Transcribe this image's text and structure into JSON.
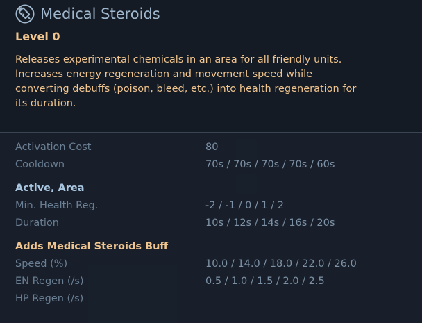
{
  "skill": {
    "title": "Medical Steroids",
    "level": "Level 0",
    "description": "Releases experimental chemicals in an area for all friendly units. Increases energy regeneration and movement speed while converting debuffs (poison, bleed, etc.) into health regeneration for its duration.",
    "icon": "syringe-icon"
  },
  "stats": {
    "activation_cost": {
      "label": "Activation Cost",
      "value": "80"
    },
    "cooldown": {
      "label": "Cooldown",
      "value": "70s / 70s / 70s / 70s / 60s"
    }
  },
  "active_area": {
    "heading": "Active, Area",
    "min_health_reg": {
      "label": "Min. Health Reg.",
      "value": "-2 / -1 / 0 / 1 / 2"
    },
    "duration": {
      "label": "Duration",
      "value": "10s / 12s / 14s / 16s / 20s"
    }
  },
  "buff": {
    "heading": "Adds Medical Steroids Buff",
    "speed": {
      "label": "Speed (%)",
      "value": "10.0 / 14.0 / 18.0 / 22.0 / 26.0"
    },
    "en_regen": {
      "label": "EN Regen (/s)",
      "value": "0.5 / 1.0 / 1.5 / 2.0 / 2.5"
    },
    "hp_regen": {
      "label": "HP Regen (/s)",
      "value": ""
    }
  },
  "colors": {
    "title": "#9fb6cc",
    "accent": "#f0c48e",
    "label": "#6a7f93",
    "value": "#7d92a6",
    "section": "#a9c6e0"
  }
}
